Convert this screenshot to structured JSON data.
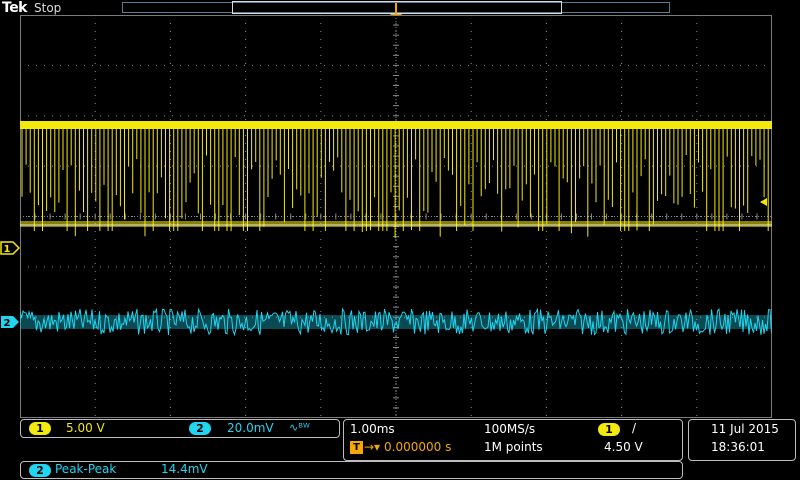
{
  "header": {
    "brand": "Tek",
    "state": "Stop"
  },
  "trigger_label": "T",
  "channels": [
    {
      "number": "1",
      "scale": "5.00 V",
      "color": "#f2e90e"
    },
    {
      "number": "2",
      "scale": "20.0mV",
      "coupling_icon": "bandwidth-limit-icon",
      "coupling_glyph": "∿ᴮᵂ",
      "color": "#21d4ef"
    }
  ],
  "timebase": {
    "time_per_div": "1.00ms",
    "sample_rate": "100MS/s",
    "trigger_delay": "0.000000 s",
    "record_length": "1M points"
  },
  "trigger": {
    "source": "1",
    "slope_icon": "rising-edge-icon",
    "slope_glyph": "/",
    "level": "4.50 V"
  },
  "datetime": {
    "date": "11 Jul  2015",
    "time": "18:36:01"
  },
  "measurement": {
    "source": "2",
    "type": "Peak-Peak",
    "value": "14.4mV"
  },
  "colors": {
    "ch1": "#f2e90e",
    "ch2": "#21d4ef",
    "trigger": "#f5a800",
    "grid": "#8a8a8a"
  }
}
